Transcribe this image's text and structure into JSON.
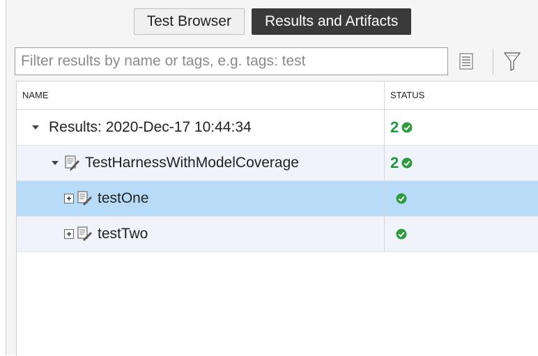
{
  "tabs": [
    {
      "label": "Test Browser",
      "active": false
    },
    {
      "label": "Results and Artifacts",
      "active": true
    }
  ],
  "filter": {
    "placeholder": "Filter results by name or tags, e.g. tags: test",
    "value": ""
  },
  "toolbar": {
    "list_icon": "list-icon",
    "filter_icon": "funnel-icon"
  },
  "table": {
    "headers": [
      "NAME",
      "STATUS"
    ],
    "rows": [
      {
        "name": "Results: 2020-Dec-17 10:44:34",
        "count": "2",
        "status": "passed"
      },
      {
        "name": "TestHarnessWithModelCoverage",
        "count": "2",
        "status": "passed"
      },
      {
        "name": "testOne",
        "count": "",
        "status": "passed",
        "selected": true
      },
      {
        "name": "testTwo",
        "count": "",
        "status": "passed"
      }
    ]
  },
  "colors": {
    "pass": "#2e9b3e",
    "selected_row": "#b8dcf7",
    "active_tab": "#3a3a3a"
  }
}
